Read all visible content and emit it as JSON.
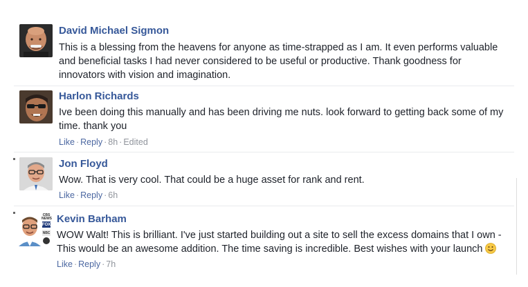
{
  "comments": [
    {
      "author": "David Michael Sigmon",
      "text": "This is a blessing from the heavens for anyone as time-strapped as I am. It even performs valuable and beneficial tasks I had never considered to be useful or productive. Thank goodness for innovators with vision and imagination.",
      "avatar_icon": "avatar-bald-man-icon"
    },
    {
      "author": "Harlon Richards",
      "text": "Ive been doing this manually and has been driving me nuts. look forward to getting back some of my time. thank you",
      "like": "Like",
      "reply": "Reply",
      "time": "8h",
      "edited": "Edited",
      "avatar_icon": "avatar-man-sunglasses-icon"
    },
    {
      "author": "Jon Floyd",
      "text": "Wow. That is very cool. That could be a huge asset for rank and rent.",
      "like": "Like",
      "reply": "Reply",
      "time": "6h",
      "avatar_icon": "avatar-man-glasses-icon"
    },
    {
      "author": "Kevin Barham",
      "text": "WOW Walt! This is brilliant. I've just started building out a site to sell the excess domains that I own - This would be an awesome addition. The time saving is incredible. Best wishes with your launch",
      "like": "Like",
      "reply": "Reply",
      "time": "7h",
      "avatar_icon": "avatar-man-news-logos-icon",
      "emoji": "smiley-emoji-icon",
      "avatar_badges": [
        "CBS NEWS",
        "FOX",
        "NBC"
      ]
    }
  ],
  "separator": "·",
  "colors": {
    "author": "#365899",
    "link": "#4b67a1",
    "meta": "#90949c",
    "text": "#1d2129"
  }
}
